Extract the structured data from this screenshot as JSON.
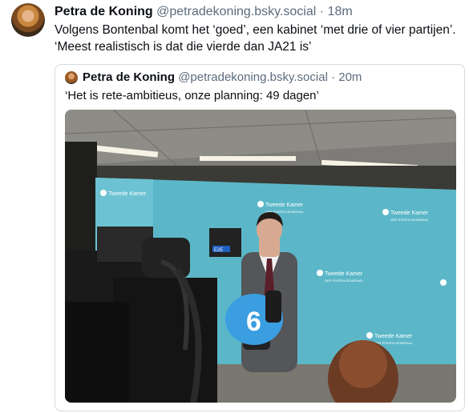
{
  "post": {
    "author_name": "Petra de Koning",
    "author_handle": "@petradekoning.bsky.social",
    "separator": "·",
    "time": "18m",
    "text_line1": "Volgens Bontenbal komt het ‘goed’, een kabinet ‘met drie of vier partijen’.",
    "text_line2": "‘Meest realistisch is dat die vierde dan JA21 is’"
  },
  "quote": {
    "author_name": "Petra de Koning",
    "author_handle": "@petradekoning.bsky.social",
    "separator": "·",
    "time": "20m",
    "text": "‘Het is rete-ambitieus, onze planning: 49 dagen’"
  },
  "photo": {
    "backdrop_logo_text": "Tweede Kamer",
    "backdrop_logo_subtext": "DER STATEN-GENERAAL",
    "mic_logo": "6",
    "camera_label": "E2E"
  }
}
